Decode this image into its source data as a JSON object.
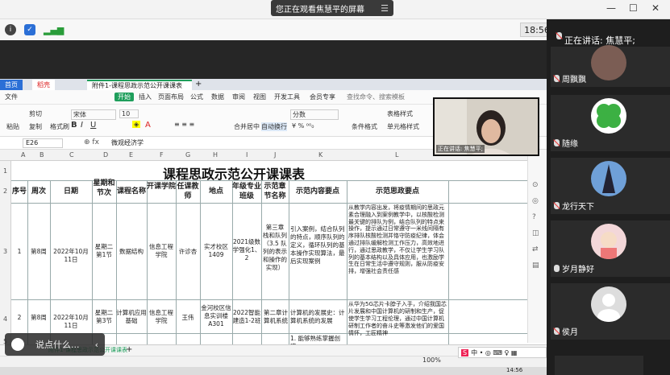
{
  "meeting": {
    "share_banner": "您正在观看焦慧平的屏幕",
    "clock": "18:56",
    "speaking": "正在讲话: 焦慧平;"
  },
  "participants": [
    {
      "name": "周飘飘",
      "avatar": "grey"
    },
    {
      "name": "随缘",
      "avatar": "clover"
    },
    {
      "name": "龙行天下",
      "avatar": "tower"
    },
    {
      "name": "岁月静好",
      "avatar": "girl"
    },
    {
      "name": "侯月",
      "avatar": "default"
    }
  ],
  "wps": {
    "tabs": [
      "首页",
      "稻壳",
      "附件1-课程思政示范公开课课表"
    ],
    "menu": [
      "文件",
      "开始",
      "插入",
      "页面布局",
      "公式",
      "数据",
      "审阅",
      "视图",
      "开发工具",
      "会员专享",
      "查找命令、搜索模板"
    ],
    "ribbon": {
      "cut": "剪切",
      "copy": "复制",
      "format_painter": "格式刷",
      "paste": "粘贴",
      "font": "宋体",
      "font_size": "10",
      "merge": "合并居中",
      "wrap": "自动换行",
      "num_format": "分数",
      "cond_format": "条件格式",
      "table_style": "表格样式",
      "cell_style": "单元格样式"
    },
    "cell_ref": "E26",
    "formula_value": "微观经济学",
    "columns": [
      "A",
      "B",
      "C",
      "D",
      "E",
      "F",
      "G",
      "H",
      "I",
      "J",
      "K",
      "L"
    ],
    "rows": [
      "1",
      "2",
      "3",
      "4",
      "5"
    ],
    "sheet_title": "课程思政示范公开课课表",
    "headers": [
      "序号",
      "周次",
      "日期",
      "星期和节次",
      "课程名称",
      "开课学院",
      "任课教师",
      "地点",
      "年级专业班级",
      "示范章节名称",
      "示范内容要点",
      "示范思政要点"
    ],
    "table": [
      [
        "1",
        "第8周",
        "2022年10月11日",
        "星期二 第1节",
        "数据结构",
        "信息工程学院",
        "许诊杏",
        "实才校区1409",
        "2021级数学强化1、2",
        "第三章 栈和队列（3.5 队列的表示和操作的实现）",
        "引入案例，结合队列的特点，顺序队列的定义，循环队列的基本操作实现算法，最后实现案例",
        "从教学内容出发，将疫情期间的思政元素合理融入到案例教学中，以核酸检测最关键的排队为例，结合队列的特点来操作，提示通过日常遵守一米线间隔有序排队核酸检测并恪守防疫纪律，体会通过排队缓解检测工作压力，高效地进行，通过思政教学，不仅让学生学习队列的基本结构以及具体应用，也激励学生在日常生活中遵守规则，服从防疫安排，增强社会责任感"
      ],
      [
        "2",
        "第8周",
        "2022年10月11日",
        "星期二 第3节",
        "计算机应用基础",
        "信息工程学院",
        "王伟",
        "金河校区信息实训楼A301",
        "2022智能建造1-2班",
        "第二章计算机系统",
        "计算机的发展史：计算机系统的发展",
        "从华为5G芯片卡脖子入手，介绍我国芯片发展和中国计算机的研制和生产，促使学生学习工程伦理，通过中国计算机研制工作者的奋斗史等激发他们的爱国情怀，工匠精神"
      ],
      [
        "",
        "",
        "",
        "",
        "",
        "",
        "",
        "",
        "",
        "",
        "1. 能够熟练掌握创建",
        ""
      ]
    ],
    "sheet_tab": "附件1-课程思政示范公开课课表",
    "zoom": "100%",
    "taskbar_time": "14:56"
  },
  "chat": {
    "placeholder": "说点什么..."
  },
  "colors": {
    "wps_green": "#1e9e5b",
    "panel_bg": "#1e1e1e",
    "accent_blue": "#2b6fd6"
  }
}
